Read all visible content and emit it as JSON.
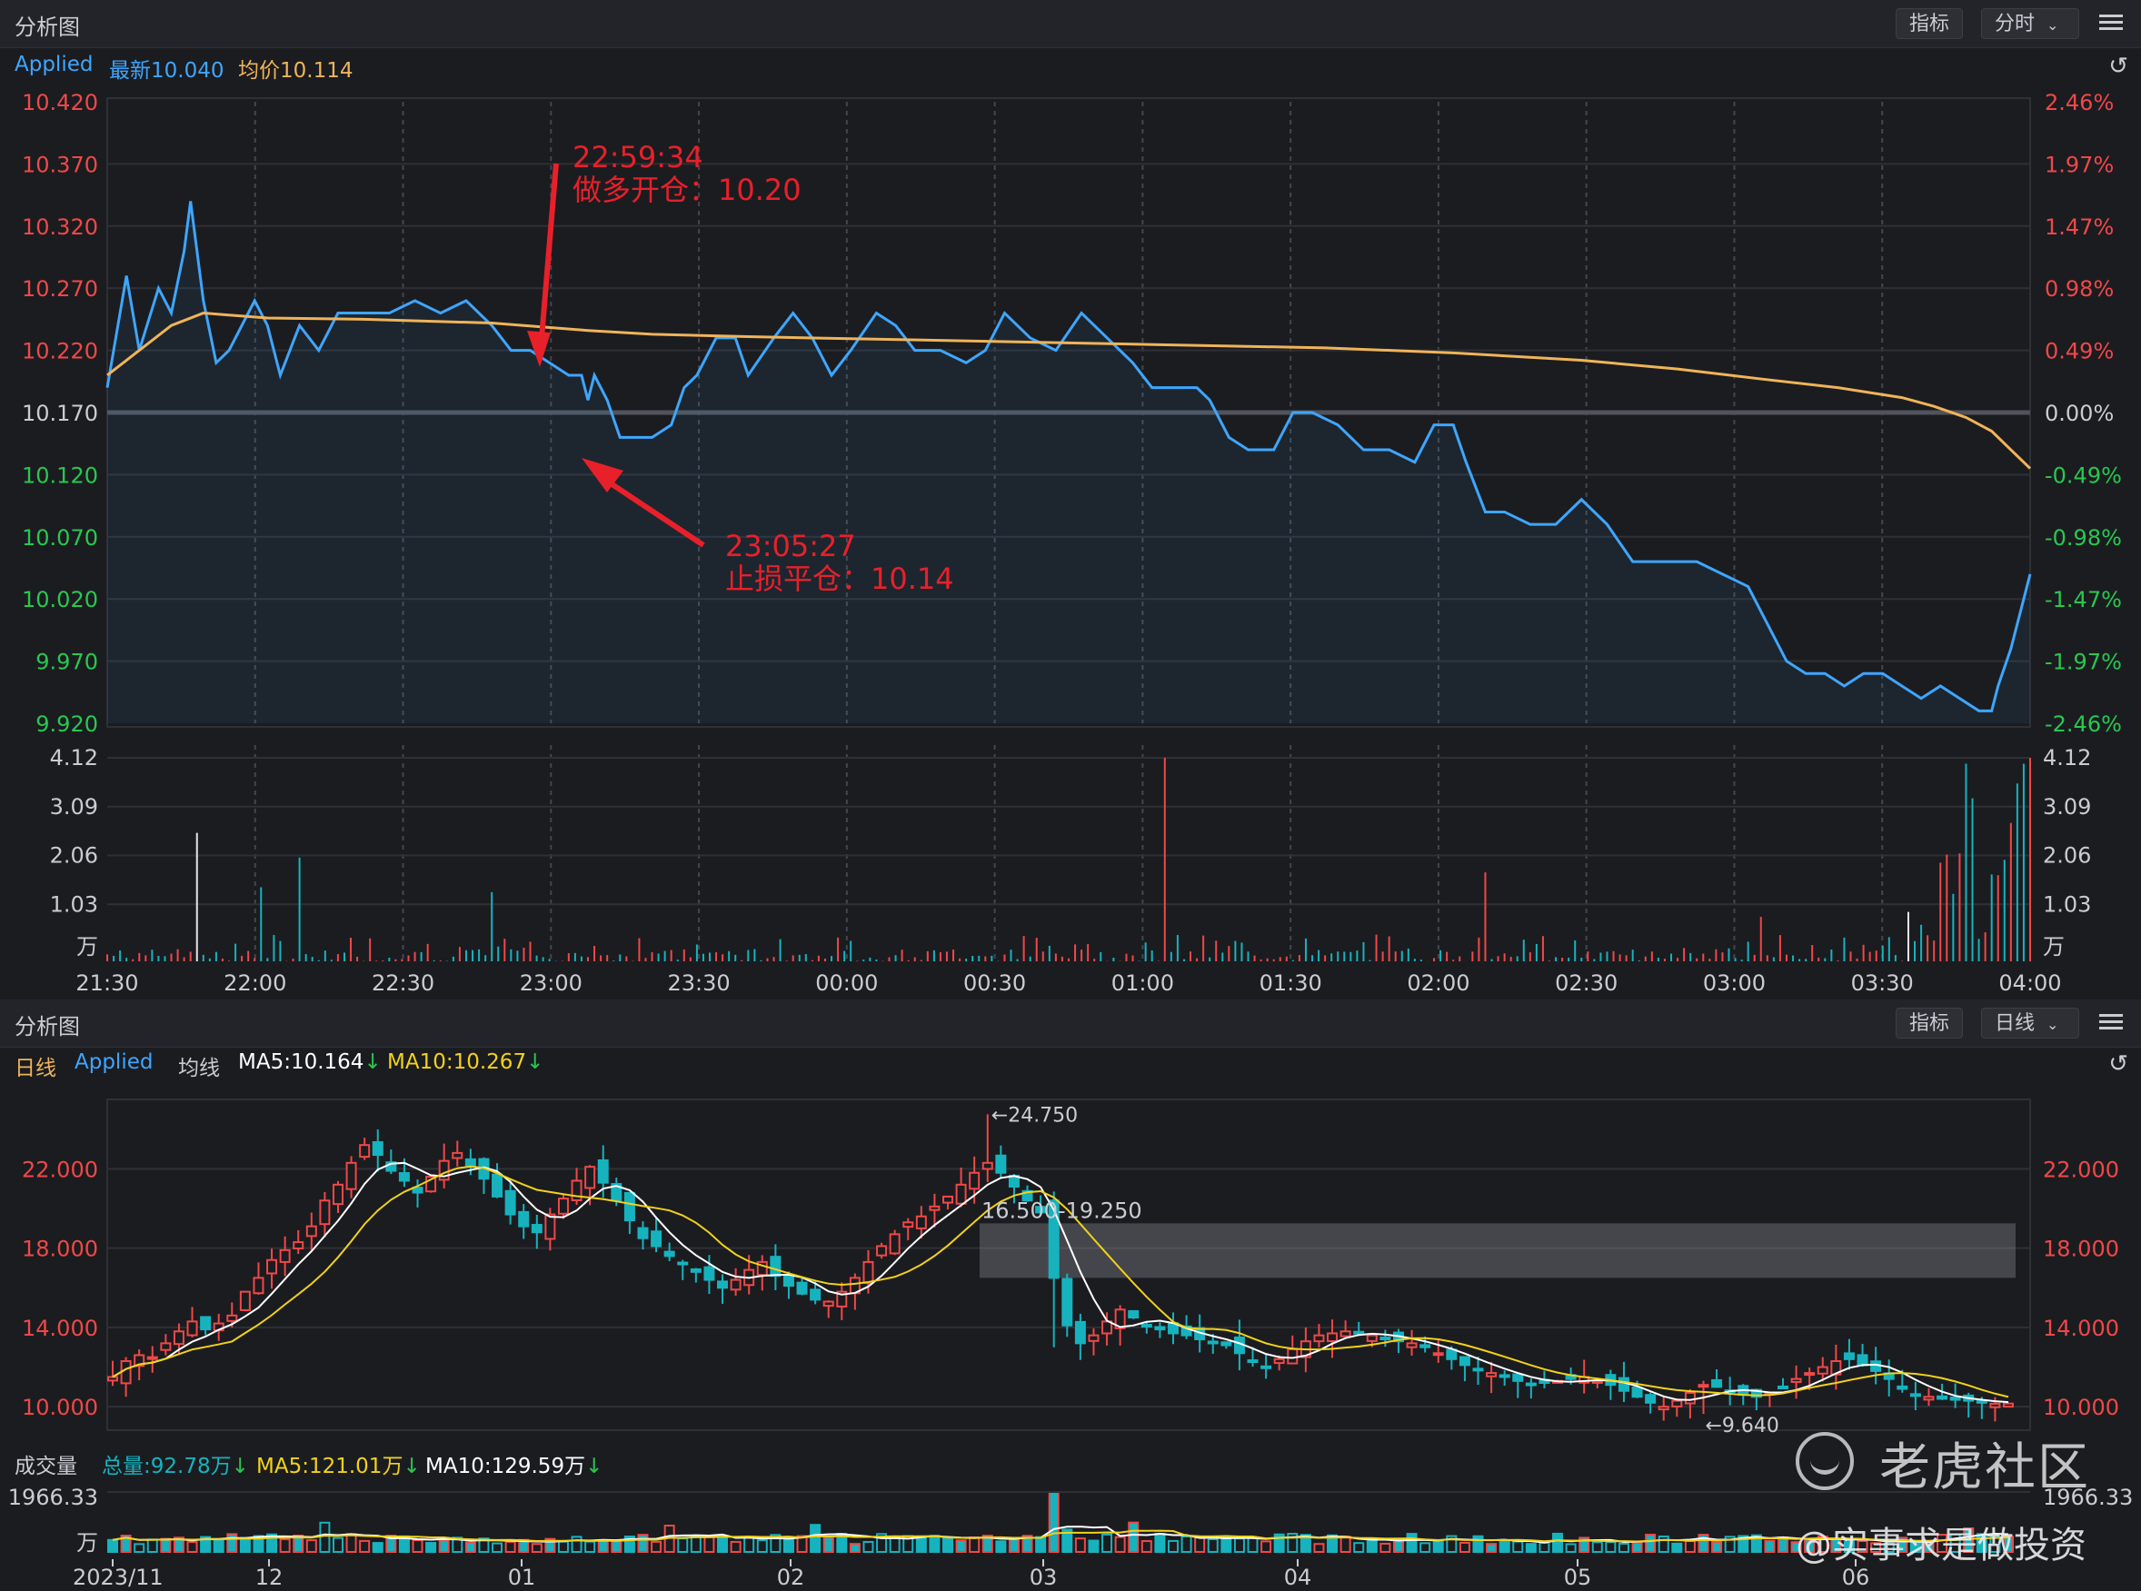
{
  "top_panel": {
    "title": "分析图",
    "btn_indicator": "指标",
    "btn_period": "分时",
    "info": {
      "symbol": "Applied",
      "latest": "最新10.040",
      "avg": "均价10.114"
    },
    "annotations": [
      {
        "time": "22:59:34",
        "text": "做多开仓：10.20"
      },
      {
        "time": "23:05:27",
        "text": "止损平仓：10.14"
      }
    ]
  },
  "bottom_panel": {
    "title": "分析图",
    "btn_indicator": "指标",
    "btn_period": "日线",
    "info": {
      "period": "日线",
      "symbol": "Applied",
      "ma_label": "均线",
      "ma5": "MA5:10.164",
      "ma10": "MA10:10.267"
    },
    "volume_info": {
      "label": "成交量",
      "total": "总量:92.78万",
      "ma5": "MA5:121.01万",
      "ma10": "MA10:129.59万"
    },
    "markers": {
      "high": "←24.750",
      "low": "←9.640",
      "zone": "16.500-19.250"
    }
  },
  "watermark": {
    "brand": "老虎社区",
    "author": "@实事求是做投资"
  },
  "colors": {
    "up": "#f04848",
    "down": "#16b3bf",
    "price": "#3ea6ff",
    "avg": "#f0b45a",
    "ma5": "#ffffff",
    "ma10": "#f2d21a",
    "annot": "#e8202a",
    "green": "#28c850"
  },
  "chart_data": [
    {
      "type": "line",
      "title": "",
      "x_ticks": [
        "21:30",
        "22:00",
        "22:30",
        "23:00",
        "23:30",
        "00:00",
        "00:30",
        "01:00",
        "01:30",
        "02:00",
        "02:30",
        "03:00",
        "03:30",
        "04:00"
      ],
      "y_ticks_left": [
        "10.420",
        "10.370",
        "10.320",
        "10.270",
        "10.220",
        "10.170",
        "10.120",
        "10.070",
        "10.020",
        "9.970",
        "9.920"
      ],
      "y_ticks_right": [
        "2.46%",
        "1.97%",
        "1.47%",
        "0.98%",
        "0.49%",
        "0.00%",
        "-0.49%",
        "-0.98%",
        "-1.47%",
        "-1.97%",
        "-2.46%"
      ],
      "ylim": [
        9.92,
        10.42
      ],
      "prev_close": 10.17,
      "series": [
        {
          "name": "最新",
          "points": [
            [
              0,
              10.19
            ],
            [
              3,
              10.28
            ],
            [
              5,
              10.22
            ],
            [
              8,
              10.27
            ],
            [
              10,
              10.25
            ],
            [
              12,
              10.3
            ],
            [
              13,
              10.34
            ],
            [
              15,
              10.26
            ],
            [
              17,
              10.21
            ],
            [
              19,
              10.22
            ],
            [
              21,
              10.24
            ],
            [
              23,
              10.26
            ],
            [
              25,
              10.24
            ],
            [
              27,
              10.2
            ],
            [
              30,
              10.24
            ],
            [
              33,
              10.22
            ],
            [
              36,
              10.25
            ],
            [
              40,
              10.25
            ],
            [
              44,
              10.25
            ],
            [
              48,
              10.26
            ],
            [
              52,
              10.25
            ],
            [
              56,
              10.26
            ],
            [
              60,
              10.24
            ],
            [
              63,
              10.22
            ],
            [
              66,
              10.22
            ],
            [
              69,
              10.21
            ],
            [
              72,
              10.2
            ],
            [
              74,
              10.2
            ],
            [
              75,
              10.18
            ],
            [
              76,
              10.2
            ],
            [
              78,
              10.18
            ],
            [
              80,
              10.15
            ],
            [
              82,
              10.15
            ],
            [
              85,
              10.15
            ],
            [
              88,
              10.16
            ],
            [
              90,
              10.19
            ],
            [
              92,
              10.2
            ],
            [
              95,
              10.23
            ],
            [
              98,
              10.23
            ],
            [
              100,
              10.2
            ],
            [
              104,
              10.23
            ],
            [
              107,
              10.25
            ],
            [
              110,
              10.23
            ],
            [
              113,
              10.2
            ],
            [
              116,
              10.22
            ],
            [
              120,
              10.25
            ],
            [
              123,
              10.24
            ],
            [
              126,
              10.22
            ],
            [
              130,
              10.22
            ],
            [
              134,
              10.21
            ],
            [
              137,
              10.22
            ],
            [
              140,
              10.25
            ],
            [
              144,
              10.23
            ],
            [
              148,
              10.22
            ],
            [
              152,
              10.25
            ],
            [
              156,
              10.23
            ],
            [
              160,
              10.21
            ],
            [
              163,
              10.19
            ],
            [
              167,
              10.19
            ],
            [
              170,
              10.19
            ],
            [
              172,
              10.18
            ],
            [
              175,
              10.15
            ],
            [
              178,
              10.14
            ],
            [
              182,
              10.14
            ],
            [
              185,
              10.17
            ],
            [
              188,
              10.17
            ],
            [
              192,
              10.16
            ],
            [
              196,
              10.14
            ],
            [
              200,
              10.14
            ],
            [
              204,
              10.13
            ],
            [
              207,
              10.16
            ],
            [
              210,
              10.16
            ],
            [
              212,
              10.13
            ],
            [
              215,
              10.09
            ],
            [
              218,
              10.09
            ],
            [
              222,
              10.08
            ],
            [
              226,
              10.08
            ],
            [
              230,
              10.1
            ],
            [
              234,
              10.08
            ],
            [
              238,
              10.05
            ],
            [
              240,
              10.05
            ],
            [
              244,
              10.05
            ],
            [
              248,
              10.05
            ],
            [
              252,
              10.04
            ],
            [
              256,
              10.03
            ],
            [
              260,
              9.99
            ],
            [
              262,
              9.97
            ],
            [
              265,
              9.96
            ],
            [
              268,
              9.96
            ],
            [
              271,
              9.95
            ],
            [
              274,
              9.96
            ],
            [
              277,
              9.96
            ],
            [
              280,
              9.95
            ],
            [
              283,
              9.94
            ],
            [
              286,
              9.95
            ],
            [
              289,
              9.94
            ],
            [
              292,
              9.93
            ],
            [
              294,
              9.93
            ],
            [
              295,
              9.95
            ],
            [
              297,
              9.98
            ],
            [
              299,
              10.02
            ],
            [
              300,
              10.04
            ]
          ]
        },
        {
          "name": "均价",
          "points": [
            [
              0,
              10.2
            ],
            [
              5,
              10.22
            ],
            [
              10,
              10.24
            ],
            [
              15,
              10.25
            ],
            [
              25,
              10.246
            ],
            [
              40,
              10.245
            ],
            [
              60,
              10.242
            ],
            [
              75,
              10.236
            ],
            [
              85,
              10.233
            ],
            [
              100,
              10.231
            ],
            [
              130,
              10.228
            ],
            [
              160,
              10.225
            ],
            [
              190,
              10.222
            ],
            [
              210,
              10.218
            ],
            [
              230,
              10.212
            ],
            [
              245,
              10.205
            ],
            [
              258,
              10.197
            ],
            [
              270,
              10.19
            ],
            [
              280,
              10.182
            ],
            [
              285,
              10.175
            ],
            [
              290,
              10.166
            ],
            [
              294,
              10.155
            ],
            [
              297,
              10.14
            ],
            [
              300,
              10.125
            ]
          ]
        }
      ]
    },
    {
      "type": "bar",
      "title": "",
      "y_ticks": [
        "4.12",
        "3.09",
        "2.06",
        "1.03",
        "万"
      ],
      "ylim": [
        0,
        4.12
      ]
    },
    {
      "type": "candlestick",
      "title": "",
      "x_ticks": [
        "2023/11",
        "12",
        "01",
        "02",
        "03",
        "04",
        "05",
        "06"
      ],
      "y_ticks": [
        "22.000",
        "18.000",
        "14.000",
        "10.000"
      ],
      "ylim": [
        9.0,
        25.5
      ],
      "closes": [
        11.5,
        12.3,
        12.6,
        12.5,
        13.2,
        13.8,
        14.3,
        13.9,
        14.2,
        14.6,
        15.8,
        16.5,
        17.4,
        17.9,
        18.3,
        19.1,
        20.4,
        21.2,
        22.3,
        23.2,
        22.7,
        21.9,
        21.4,
        20.8,
        21.6,
        22.4,
        22.8,
        22.1,
        21.5,
        20.6,
        19.7,
        19.1,
        18.8,
        19.7,
        20.5,
        21.4,
        22.1,
        21.3,
        20.4,
        19.4,
        18.5,
        18.1,
        17.6,
        17.2,
        16.8,
        16.4,
        16.0,
        16.4,
        16.9,
        17.3,
        16.6,
        16.1,
        15.7,
        15.4,
        15.3,
        15.8,
        16.5,
        17.3,
        18.1,
        18.7,
        19.3,
        19.6,
        20.1,
        20.6,
        21.2,
        21.8,
        22.3,
        21.8,
        21.1,
        20.4,
        19.8,
        16.5,
        14.1,
        13.2,
        13.6,
        14.3,
        14.9,
        14.5,
        14.1,
        13.9,
        13.7,
        13.6,
        13.4,
        13.2,
        13.1,
        12.7,
        12.3,
        12.0,
        12.4,
        12.9,
        13.3,
        13.6,
        13.7,
        13.8,
        13.7,
        13.6,
        13.4,
        13.3,
        13.2,
        13.0,
        12.7,
        12.4,
        12.1,
        11.9,
        11.7,
        11.5,
        11.3,
        11.1,
        11.2,
        11.3,
        11.4,
        11.5,
        11.3,
        11.1,
        10.8,
        10.5,
        10.2,
        10.0,
        10.3,
        10.7,
        11.1,
        11.0,
        10.8,
        10.6,
        10.5,
        10.7,
        11.0,
        11.4,
        11.7,
        12.0,
        12.3,
        12.4,
        12.1,
        11.8,
        11.4,
        10.9,
        10.6,
        10.5,
        10.4,
        10.35,
        10.3,
        10.2,
        10.15,
        10.16
      ],
      "high_marker": 24.75,
      "low_marker": 9.64,
      "zone": [
        16.5,
        19.25
      ]
    },
    {
      "type": "bar",
      "title": "",
      "y_ticks": [
        "1966.33",
        "万"
      ],
      "ylim": [
        0,
        1966.33
      ]
    }
  ]
}
